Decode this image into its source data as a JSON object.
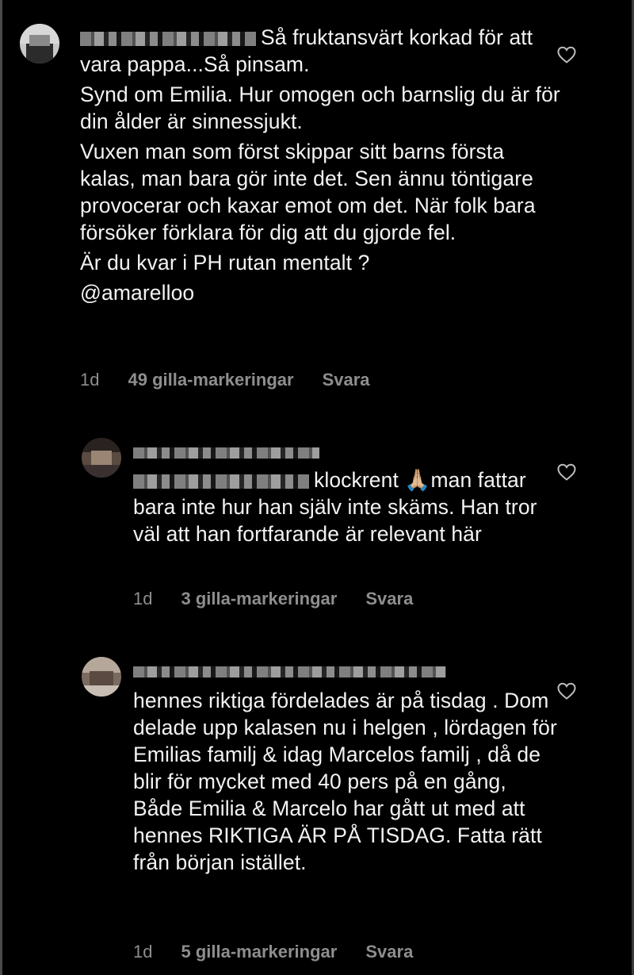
{
  "comments": [
    {
      "username": "",
      "paragraphs": [
        "Så fruktansvärt korkad för att vara pappa...Så pinsam.",
        "Synd om Emilia. Hur omogen och barnslig du är för din ålder är sinnessjukt.",
        "Vuxen man som först skippar sitt barns första kalas, man bara gör inte det. Sen ännu töntigare provocerar och kaxar emot om det. När folk bara försöker förklara för dig att du gjorde fel.",
        "Är du kvar i PH rutan mentalt ?",
        "@amarelloo"
      ],
      "time": "1d",
      "likes": "49 gilla-markeringar",
      "reply": "Svara"
    },
    {
      "username": "",
      "paragraphs": [
        "klockrent 🙏🏼man fattar bara inte hur han själv inte skäms. Han tror väl att han fortfarande är relevant här"
      ],
      "time": "1d",
      "likes": "3 gilla-markeringar",
      "reply": "Svara"
    },
    {
      "username": "",
      "paragraphs": [
        "hennes riktiga fördelades är på tisdag . Dom delade upp kalasen nu i helgen , lördagen för Emilias familj & idag Marcelos familj , då de blir för mycket med 40 pers på en gång, Både Emilia & Marcelo har gått ut med att hennes RIKTIGA ÄR PÅ TISDAG. Fatta rätt från början istället."
      ],
      "time": "1d",
      "likes": "5 gilla-markeringar",
      "reply": "Svara"
    }
  ],
  "icons": {
    "like": "heart-outline-icon"
  },
  "colors": {
    "background": "#000000",
    "text": "#f2f2f2",
    "meta": "#8e8e8e"
  }
}
